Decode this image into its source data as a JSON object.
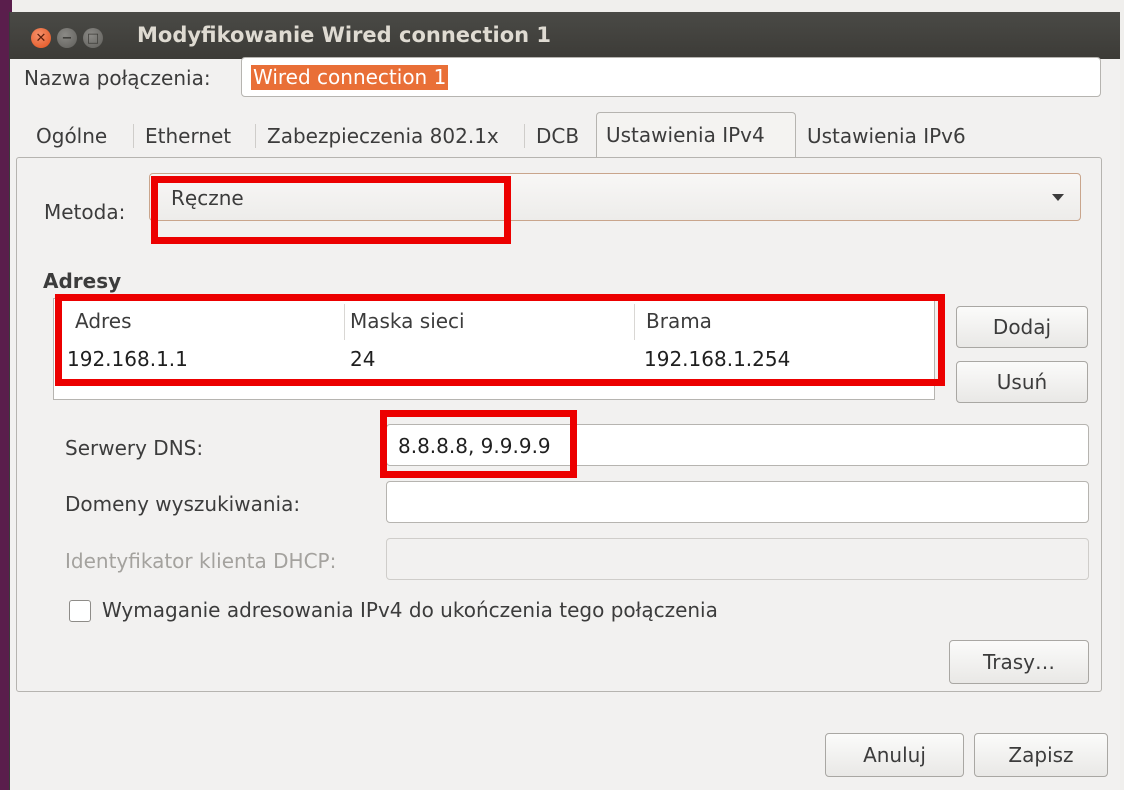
{
  "window": {
    "title": "Modyfikowanie Wired connection 1",
    "close_glyph": "✕",
    "min_glyph": "−",
    "max_glyph": "□"
  },
  "connection_name": {
    "label": "Nazwa połączenia:",
    "value": "Wired connection 1"
  },
  "tabs": [
    {
      "label": "Ogólne",
      "active": false
    },
    {
      "label": "Ethernet",
      "active": false
    },
    {
      "label": "Zabezpieczenia 802.1x",
      "active": false
    },
    {
      "label": "DCB",
      "active": false
    },
    {
      "label": "Ustawienia IPv4",
      "active": true
    },
    {
      "label": "Ustawienia IPv6",
      "active": false
    }
  ],
  "method": {
    "label": "Metoda:",
    "value": "Ręczne"
  },
  "addresses": {
    "heading": "Adresy",
    "columns": [
      "Adres",
      "Maska sieci",
      "Brama"
    ],
    "rows": [
      [
        "192.168.1.1",
        "24",
        "192.168.1.254"
      ]
    ],
    "add_button": "Dodaj",
    "remove_button": "Usuń"
  },
  "dns": {
    "label": "Serwery DNS:",
    "value": "8.8.8.8, 9.9.9.9"
  },
  "search_domains": {
    "label": "Domeny wyszukiwania:",
    "value": ""
  },
  "dhcp_client_id": {
    "label": "Identyfikator klienta DHCP:",
    "value": ""
  },
  "require_ipv4": {
    "label": "Wymaganie adresowania IPv4 do ukończenia tego połączenia",
    "checked": false
  },
  "routes_button": "Trasy…",
  "footer": {
    "cancel": "Anuluj",
    "save": "Zapisz"
  },
  "colors": {
    "highlight_box": "#ec0000",
    "selection": "#e96f37",
    "close_button": "#e2501c"
  }
}
